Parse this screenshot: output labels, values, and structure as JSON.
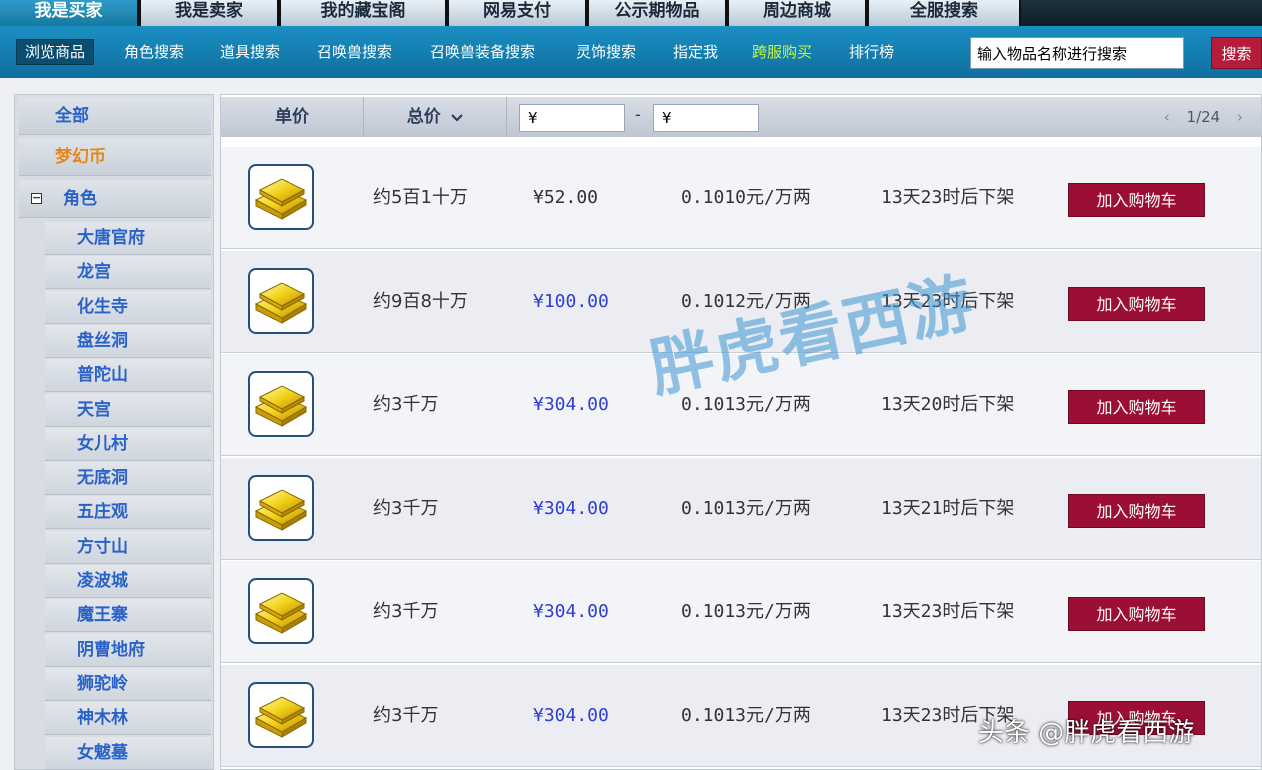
{
  "top_tabs": [
    {
      "label": "我是买家",
      "active": true
    },
    {
      "label": "我是卖家",
      "active": false
    },
    {
      "label": "我的藏宝阁",
      "active": false
    },
    {
      "label": "网易支付",
      "active": false
    },
    {
      "label": "公示期物品",
      "active": false
    },
    {
      "label": "周边商城",
      "active": false
    },
    {
      "label": "全服搜索",
      "active": false
    }
  ],
  "sub_nav": [
    {
      "label": "浏览商品",
      "active": true
    },
    {
      "label": "角色搜索"
    },
    {
      "label": "道具搜索"
    },
    {
      "label": "召唤兽搜索"
    },
    {
      "label": "召唤兽装备搜索"
    },
    {
      "label": "灵饰搜索"
    },
    {
      "label": "指定我"
    },
    {
      "label": "跨服购买",
      "highlight": true
    },
    {
      "label": "排行榜"
    }
  ],
  "search": {
    "value": "输入物品名称进行搜索",
    "button": "搜索"
  },
  "sidebar": {
    "all": "全部",
    "coin": "梦幻币",
    "role": "角色",
    "collapse_symbol": "−",
    "schools": [
      "大唐官府",
      "龙宫",
      "化生寺",
      "盘丝洞",
      "普陀山",
      "天宫",
      "女儿村",
      "无底洞",
      "五庄观",
      "方寸山",
      "凌波城",
      "魔王寨",
      "阴曹地府",
      "狮驼岭",
      "神木林",
      "女魃墓"
    ]
  },
  "table_header": {
    "unit_price": "单价",
    "total_price": "总价",
    "sort_icon": "chevron-down-icon",
    "yen_min": "¥",
    "dash": "-",
    "yen_max": "¥",
    "pager": {
      "prev": "‹",
      "page": "1/24",
      "next": "›"
    }
  },
  "listings": [
    {
      "amount": "约5百1十万",
      "price": "¥52.00",
      "price_blue": false,
      "unit": "0.1010元/万两",
      "time": "13天23时后下架",
      "button": "加入购物车"
    },
    {
      "amount": "约9百8十万",
      "price": "¥100.00",
      "price_blue": true,
      "unit": "0.1012元/万两",
      "time": "13天23时后下架",
      "button": "加入购物车"
    },
    {
      "amount": "约3千万",
      "price": "¥304.00",
      "price_blue": true,
      "unit": "0.1013元/万两",
      "time": "13天20时后下架",
      "button": "加入购物车"
    },
    {
      "amount": "约3千万",
      "price": "¥304.00",
      "price_blue": true,
      "unit": "0.1013元/万两",
      "time": "13天21时后下架",
      "button": "加入购物车"
    },
    {
      "amount": "约3千万",
      "price": "¥304.00",
      "price_blue": true,
      "unit": "0.1013元/万两",
      "time": "13天23时后下架",
      "button": "加入购物车"
    },
    {
      "amount": "约3千万",
      "price": "¥304.00",
      "price_blue": true,
      "unit": "0.1013元/万两",
      "time": "13天23时后下架",
      "button": "加入购物车"
    }
  ],
  "watermark": "胖虎看西游",
  "credit": "头条 @胖虎看西游",
  "colors": {
    "tab_active": "#2f9bc9",
    "subnav_bg": "#1b8fc3",
    "cart_button": "#9b0f34",
    "search_button": "#b41c3a",
    "price_blue": "#2f3fd0",
    "coin_orange": "#e08a1c",
    "link_blue": "#2a62c8"
  }
}
